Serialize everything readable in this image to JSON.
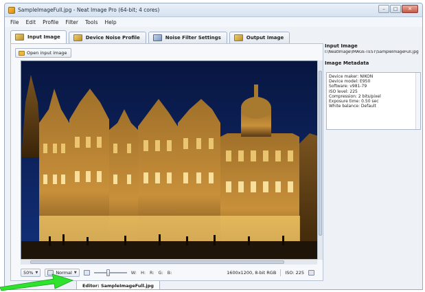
{
  "window": {
    "title": "SampleImageFull.jpg - Neat Image Pro (64-bit; 4 cores)",
    "minimize": "–",
    "maximize": "□",
    "close": "✕"
  },
  "menu": [
    "File",
    "Edit",
    "Profile",
    "Filter",
    "Tools",
    "Help"
  ],
  "tabs": [
    {
      "label": "Input Image",
      "icon": "image-icon"
    },
    {
      "label": "Device Noise Profile",
      "icon": "camera-icon"
    },
    {
      "label": "Noise Filter Settings",
      "icon": "sliders-icon"
    },
    {
      "label": "Output Image",
      "icon": "image-output-icon"
    }
  ],
  "left": {
    "open_button": "Open input image"
  },
  "status": {
    "zoom": "50%",
    "mode": "Normal",
    "w_label": "W:",
    "h_label": "H:",
    "r_label": "R:",
    "g_label": "G:",
    "b_label": "B:",
    "image_info": "1600x1200, 8-bit RGB",
    "iso": "ISO: 225"
  },
  "right": {
    "input_title": "Input Image",
    "path": "I:\\NeatImage\\IMAGE-TEST\\SampleImageFull.jpg",
    "meta_title": "Image Metadata",
    "metadata": [
      "Device maker: NIKON",
      "Device model: E950",
      "Software: v981-79",
      "ISO level: 225",
      "Compression: 2 bits/pixel",
      "Exposure time: 0.50 sec",
      "White balance: Default"
    ]
  },
  "editor_tab": "Editor: SampleImageFull.jpg",
  "colors": {
    "arrow": "#2ee22e",
    "sky": "#0c1f5c",
    "building_lit": "#e8b04a"
  }
}
